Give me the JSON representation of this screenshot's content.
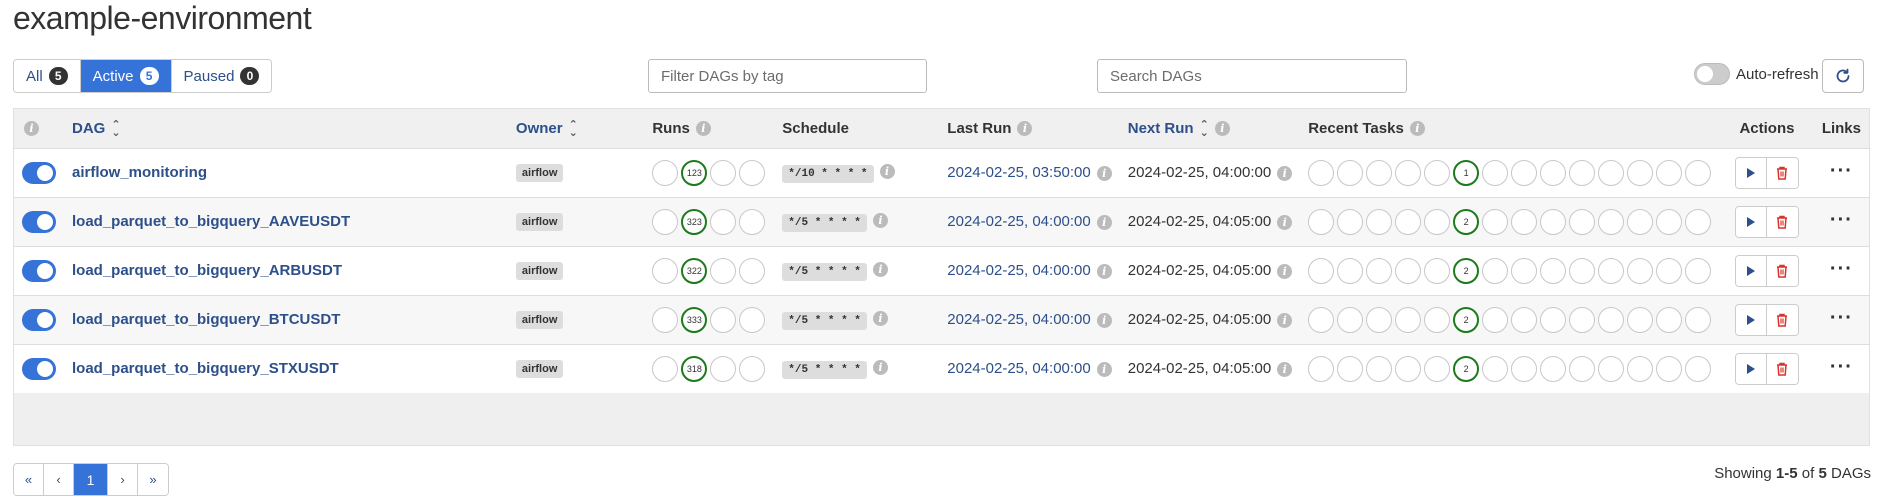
{
  "page": {
    "title": "example-environment"
  },
  "status_tabs": [
    {
      "label": "All",
      "count": "5",
      "active": false
    },
    {
      "label": "Active",
      "count": "5",
      "active": true
    },
    {
      "label": "Paused",
      "count": "0",
      "active": false
    }
  ],
  "filters": {
    "tag_placeholder": "Filter DAGs by tag",
    "search_placeholder": "Search DAGs"
  },
  "auto_refresh": {
    "label": "Auto-refresh",
    "enabled": false
  },
  "columns": {
    "dag": "DAG",
    "owner": "Owner",
    "runs": "Runs",
    "schedule": "Schedule",
    "last_run": "Last Run",
    "next_run": "Next Run",
    "recent_tasks": "Recent Tasks",
    "actions": "Actions",
    "links": "Links"
  },
  "dags": [
    {
      "name": "airflow_monitoring",
      "owner": "airflow",
      "runs": "123",
      "schedule": "*/10 * * * *",
      "last_run": "2024-02-25, 03:50:00",
      "next_run": "2024-02-25, 04:00:00",
      "recent_tasks": "1"
    },
    {
      "name": "load_parquet_to_bigquery_AAVEUSDT",
      "owner": "airflow",
      "runs": "323",
      "schedule": "*/5 * * * *",
      "last_run": "2024-02-25, 04:00:00",
      "next_run": "2024-02-25, 04:05:00",
      "recent_tasks": "2"
    },
    {
      "name": "load_parquet_to_bigquery_ARBUSDT",
      "owner": "airflow",
      "runs": "322",
      "schedule": "*/5 * * * *",
      "last_run": "2024-02-25, 04:00:00",
      "next_run": "2024-02-25, 04:05:00",
      "recent_tasks": "2"
    },
    {
      "name": "load_parquet_to_bigquery_BTCUSDT",
      "owner": "airflow",
      "runs": "333",
      "schedule": "*/5 * * * *",
      "last_run": "2024-02-25, 04:00:00",
      "next_run": "2024-02-25, 04:05:00",
      "recent_tasks": "2"
    },
    {
      "name": "load_parquet_to_bigquery_STXUSDT",
      "owner": "airflow",
      "runs": "318",
      "schedule": "*/5 * * * *",
      "last_run": "2024-02-25, 04:00:00",
      "next_run": "2024-02-25, 04:05:00",
      "recent_tasks": "2"
    }
  ],
  "pagination": {
    "first": "«",
    "prev": "‹",
    "current": "1",
    "next": "›",
    "last": "»"
  },
  "showing": {
    "prefix": "Showing",
    "range": "1-5",
    "mid": "of",
    "total": "5",
    "suffix": "DAGs"
  },
  "colors": {
    "accent": "#3673d8",
    "link": "#2d4f8a",
    "success": "#1d7a1d",
    "danger": "#d9342b"
  }
}
